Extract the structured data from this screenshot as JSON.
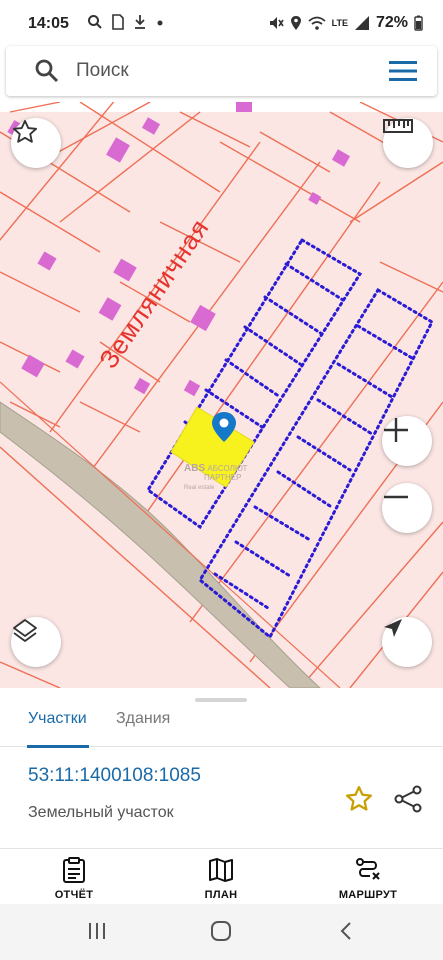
{
  "status_bar": {
    "time": "14:05",
    "battery": "72%",
    "network": "LTE",
    "icons": [
      "search-icon",
      "document-icon",
      "download-icon",
      "dot-icon",
      "mute-icon",
      "location-icon",
      "wifi-icon",
      "signal-icon",
      "battery-icon"
    ]
  },
  "search": {
    "placeholder": "Поиск"
  },
  "map": {
    "street_name": "Земляничная",
    "watermark_line1": "АБСОЛЮТ",
    "watermark_line2": "ПАРТНЕР",
    "watermark_line3": "Real estate",
    "watermark_logo": "ABS",
    "colors": {
      "background": "#fbe6e4",
      "parcel_lines": "#ef6f54",
      "buildings": "#d86ad2",
      "planned_parcels": "#2b1bd6",
      "selected_parcel": "#f7f21e",
      "road": "#c8bfae",
      "pin": "#1578c8"
    }
  },
  "tabs": {
    "parcels": "Участки",
    "buildings": "Здания"
  },
  "parcel": {
    "cadastral_number": "53:11:1400108:1085",
    "type": "Земельный участок"
  },
  "bottom_nav": {
    "report": "ОТЧЁТ",
    "plan": "ПЛАН",
    "route": "МАРШРУТ"
  }
}
